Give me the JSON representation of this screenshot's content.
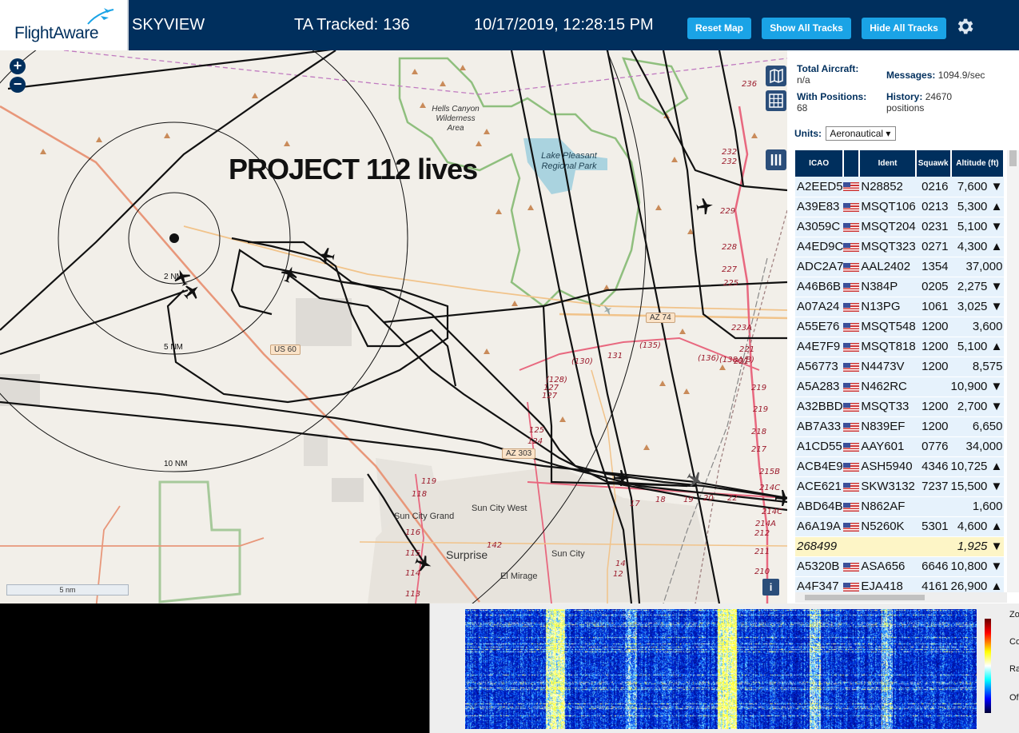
{
  "header": {
    "logo_text": "FlightAware",
    "app_title": "SKYVIEW",
    "tracked_label": "TA Tracked:",
    "tracked_count": "136",
    "datetime": "10/17/2019, 12:28:15 PM",
    "reset_map": "Reset Map",
    "show_all": "Show All Tracks",
    "hide_all": "Hide All Tracks"
  },
  "map": {
    "overlay_title": "PROJECT 112 lives",
    "scale": "5 nm",
    "ring_labels": [
      "2 NM",
      "5 NM",
      "10 NM"
    ],
    "places": [
      "Hells Canyon Wilderness Area",
      "Lake Pleasant Regional Park",
      "Sun City West",
      "Sun City Grand",
      "Surprise",
      "Sun City",
      "El Mirage"
    ],
    "roads": [
      "AZ 74",
      "US 60",
      "AZ 303"
    ]
  },
  "sidebar": {
    "total_label": "Total Aircraft:",
    "total_value": "n/a",
    "messages_label": "Messages:",
    "messages_value": "1094.9/sec",
    "positions_label": "With Positions:",
    "positions_value": "68",
    "history_label": "History:",
    "history_value": "24670 positions",
    "units_label": "Units:",
    "units_value": "Aeronautical",
    "columns": [
      "ICAO",
      "",
      "Ident",
      "Squawk",
      "Altitude (ft)"
    ],
    "rows": [
      {
        "icao": "A2EED5",
        "ident": "N28852",
        "squawk": "0216",
        "alt": "7,600 ▼"
      },
      {
        "icao": "A39E83",
        "ident": "MSQT106",
        "squawk": "0213",
        "alt": "5,300 ▲"
      },
      {
        "icao": "A3059C",
        "ident": "MSQT204",
        "squawk": "0231",
        "alt": "5,100 ▼"
      },
      {
        "icao": "A4ED9C",
        "ident": "MSQT323",
        "squawk": "0271",
        "alt": "4,300 ▲"
      },
      {
        "icao": "ADC2A7",
        "ident": "AAL2402",
        "squawk": "1354",
        "alt": "37,000"
      },
      {
        "icao": "A46B6B",
        "ident": "N384P",
        "squawk": "0205",
        "alt": "2,275 ▼"
      },
      {
        "icao": "A07A24",
        "ident": "N13PG",
        "squawk": "1061",
        "alt": "3,025 ▼"
      },
      {
        "icao": "A55E76",
        "ident": "MSQT548",
        "squawk": "1200",
        "alt": "3,600"
      },
      {
        "icao": "A4E7F9",
        "ident": "MSQT818",
        "squawk": "1200",
        "alt": "5,100 ▲"
      },
      {
        "icao": "A56773",
        "ident": "N4473V",
        "squawk": "1200",
        "alt": "8,575"
      },
      {
        "icao": "A5A283",
        "ident": "N462RC",
        "squawk": "",
        "alt": "10,900 ▼"
      },
      {
        "icao": "A32BBD",
        "ident": "MSQT33",
        "squawk": "1200",
        "alt": "2,700 ▼"
      },
      {
        "icao": "AB7A33",
        "ident": "N839EF",
        "squawk": "1200",
        "alt": "6,650"
      },
      {
        "icao": "A1CD55",
        "ident": "AAY601",
        "squawk": "0776",
        "alt": "34,000"
      },
      {
        "icao": "ACB4E9",
        "ident": "ASH5940",
        "squawk": "4346",
        "alt": "10,725 ▲"
      },
      {
        "icao": "ACE621",
        "ident": "SKW3132",
        "squawk": "7237",
        "alt": "15,500 ▼"
      },
      {
        "icao": "ABD64B",
        "ident": "N862AF",
        "squawk": "",
        "alt": "1,600"
      },
      {
        "icao": "A6A19A",
        "ident": "N5260K",
        "squawk": "5301",
        "alt": "4,600 ▲"
      },
      {
        "icao": "268499",
        "ident": "",
        "squawk": "",
        "alt": "1,925 ▼",
        "highlight": true
      },
      {
        "icao": "A5320B",
        "ident": "ASA656",
        "squawk": "6646",
        "alt": "10,800 ▼"
      },
      {
        "icao": "A4F347",
        "ident": "EJA418",
        "squawk": "4161",
        "alt": "26,900 ▲"
      }
    ]
  },
  "spectrum": {
    "controls": [
      "Zo",
      "Con",
      "Ra",
      "Of"
    ]
  },
  "colors": {
    "header_bg": "#002f5d",
    "button_bg": "#1aa3e6",
    "table_row": "#e6f2fc",
    "row_highlight": "#fdf5c6"
  }
}
